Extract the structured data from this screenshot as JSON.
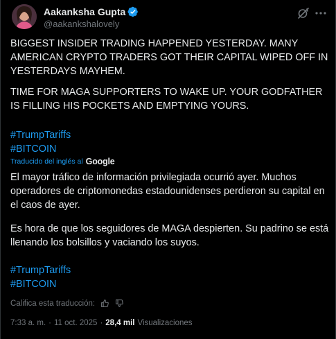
{
  "author": {
    "name": "Aakanksha Gupta",
    "handle": "@aakankshalovely"
  },
  "icons": {
    "verified": "verified-badge-icon",
    "grok": "grok-icon",
    "more": "more-options-icon",
    "thumbs_up": "thumbs-up-icon",
    "thumbs_down": "thumbs-down-icon"
  },
  "colors": {
    "background": "#000000",
    "text": "#e7e9ea",
    "muted": "#71767b",
    "link": "#1d9bf0"
  },
  "tweet": {
    "original_p1": "BIGGEST INSIDER TRADING HAPPENED YESTERDAY. MANY AMERICAN CRYPTO TRADERS GOT THEIR CAPITAL WIPED OFF IN YESTERDAYS MAYHEM.",
    "original_p2": "TIME FOR MAGA SUPPORTERS TO WAKE UP. YOUR GODFATHER IS FILLING HIS POCKETS AND EMPTYING YOURS.",
    "original_tag1": "#TrumpTariffs",
    "original_tag2": "#BITCOIN",
    "translated_label": "Traducido del inglés al",
    "translated_provider": "Google",
    "translated_p1": "El mayor tráfico de información privilegiada ocurrió ayer. Muchos operadores de criptomonedas estadounidenses perdieron su capital en el caos de ayer.",
    "translated_p2": "Es hora de que los seguidores de MAGA despierten. Su padrino se está llenando los bolsillos y vaciando los suyos.",
    "translated_tag1": "#TrumpTariffs",
    "translated_tag2": "#BITCOIN",
    "rate_label": "Califica esta traducción:"
  },
  "meta": {
    "time": "7:33 a. m.",
    "separator": "·",
    "date": "11 oct. 2025",
    "separator2": "·",
    "views_count": "28,4 mil",
    "views_label": "Visualizaciones"
  }
}
